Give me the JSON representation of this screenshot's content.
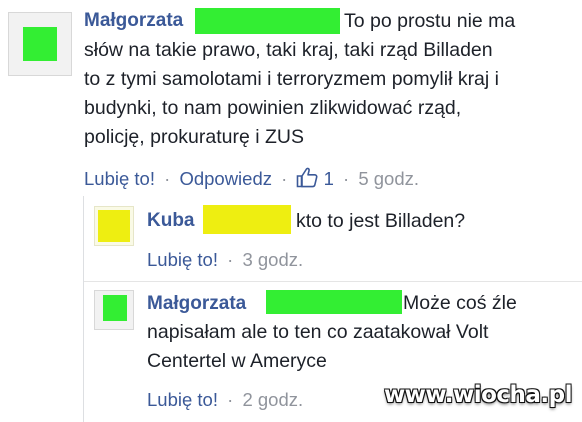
{
  "colors": {
    "link": "#3b5998",
    "muted": "#90949c",
    "censor_green": "#33ee33",
    "censor_yellow": "#eeee11"
  },
  "comments": [
    {
      "author": "Małgorzata",
      "lines": [
        "To po prostu nie ma",
        "słów na takie prawo, taki kraj, taki rząd Billaden",
        "to z tymi samolotami i terroryzmem pomylił kraj i",
        "budynki, to nam powinien zlikwidować rząd,",
        "policję, prokuraturę i ZUS"
      ],
      "like_label": "Lubię to!",
      "reply_label": "Odpowiedz",
      "likes": "1",
      "time": "5 godz."
    },
    {
      "author": "Kuba",
      "lines": [
        "kto to jest Billaden?"
      ],
      "like_label": "Lubię to!",
      "time": "3 godz."
    },
    {
      "author": "Małgorzata",
      "lines": [
        "Może coś źle",
        "napisałam ale to ten co zaatakował Volt",
        "Centertel w Ameryce"
      ],
      "like_label": "Lubię to!",
      "time": "2 godz."
    }
  ],
  "separator": "·",
  "watermark": "www.wiocha.pl"
}
